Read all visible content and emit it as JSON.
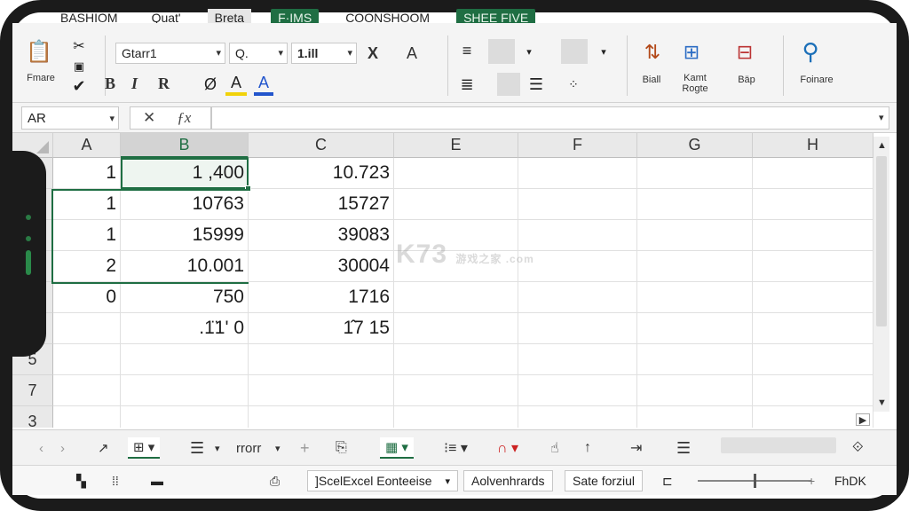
{
  "ribbon_tabs": [
    {
      "label": "BASHIOM",
      "style": "plain"
    },
    {
      "label": "Quat'",
      "style": "plain"
    },
    {
      "label": "Breta",
      "style": "grey"
    },
    {
      "label": "F·IMS",
      "style": "green"
    },
    {
      "label": "COONSHOOM",
      "style": "plain"
    },
    {
      "label": "SHEE FIVE",
      "style": "green"
    }
  ],
  "ribbon": {
    "paste_label": "Fmare",
    "font_name": "Gtarr1",
    "font_style": "Q.",
    "font_size": "1.ill",
    "bold": "B",
    "italic": "I",
    "underline": "R",
    "clear_format": "X",
    "grow_font": "A",
    "font_color_a": "A",
    "group_labels": {
      "cells": "Biall",
      "format_range": "Kamt Rogte",
      "rap": "Bäp",
      "find": "Foinare"
    }
  },
  "formula_bar": {
    "name_box": "AR",
    "cancel_glyph": "✕",
    "fx_glyph": "ƒx",
    "formula": ""
  },
  "columns": [
    "A",
    "B",
    "C",
    "E",
    "F",
    "G",
    "H"
  ],
  "row_labels": [
    "",
    "",
    "",
    "",
    "",
    "",
    "5",
    "7",
    "3"
  ],
  "cells": [
    [
      "1",
      "1 ,400",
      "10.723"
    ],
    [
      "1",
      "10763",
      "15727"
    ],
    [
      "1",
      "15999",
      "39083"
    ],
    [
      "2",
      "10.001",
      "30004"
    ],
    [
      "0",
      "750",
      "1716"
    ],
    [
      "",
      ".1̈1' 0",
      "1̂7  15"
    ]
  ],
  "watermark": "K73",
  "watermark_sub": "游戏之家 .com",
  "bottom_toolbar": {
    "sheet_label": "rrorr",
    "add_sheet": "+"
  },
  "status_bar": {
    "select_mode": "]ScelExcel Eonteeise",
    "advanced": "Aolvenhrards",
    "safe_format": "Sate forziul",
    "zoom_label": "FhDK",
    "zoom_level": 0.5
  },
  "colors": {
    "accent_green": "#1f6e43",
    "frame": "#1b1b1b"
  }
}
